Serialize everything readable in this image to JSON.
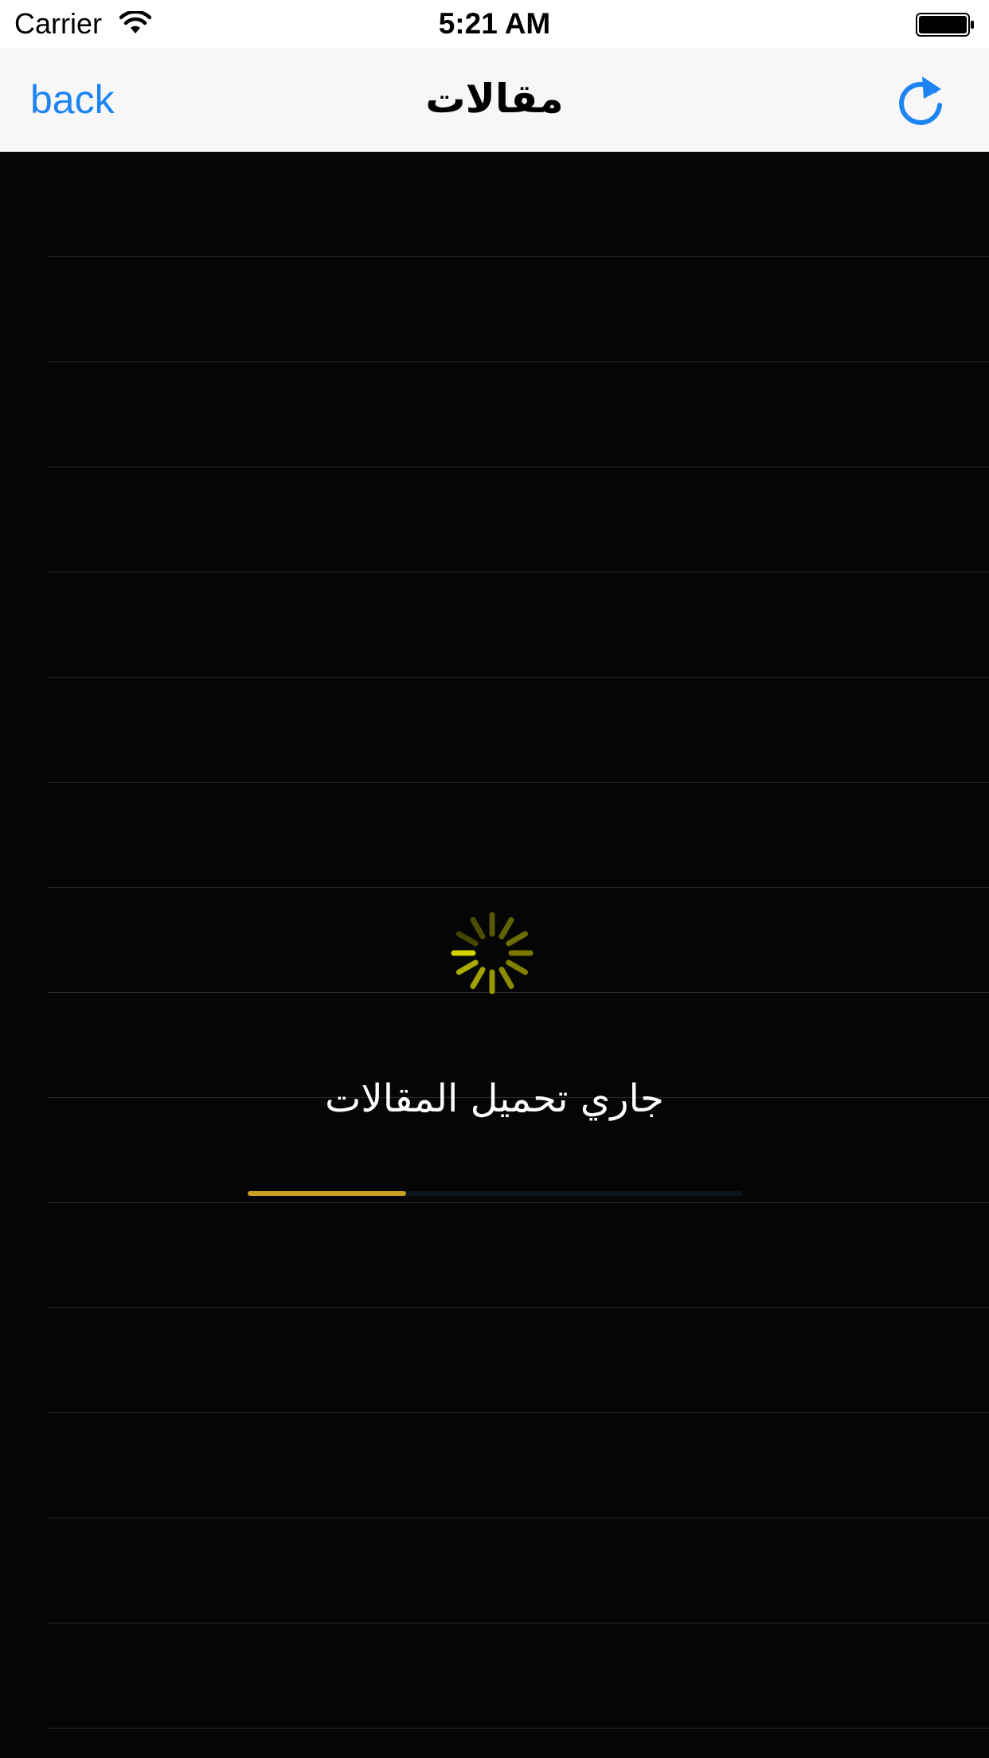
{
  "status_bar": {
    "carrier": "Carrier",
    "time": "5:21 AM",
    "icons": [
      "wifi-icon",
      "battery-icon"
    ]
  },
  "nav_bar": {
    "back_label": "back",
    "title": "مقالات",
    "refresh_icon": "refresh-icon",
    "accent_color": "#1d84f2"
  },
  "loading": {
    "message": "جاري تحميل المقالات",
    "spinner_icon": "activity-spinner-icon",
    "spinner_color": "#d4d400",
    "progress": 0.32,
    "progress_color": "#c9a020"
  },
  "colors": {
    "background": "#050505",
    "separator": "#2a2a2a"
  }
}
